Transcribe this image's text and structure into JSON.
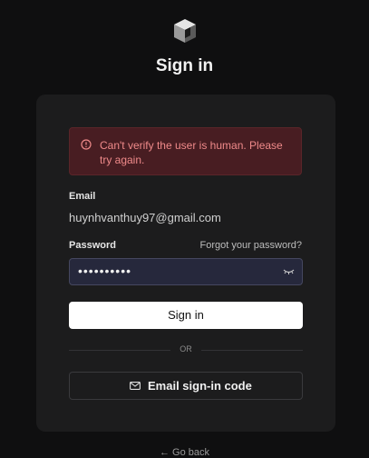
{
  "header": {
    "logo_icon": "cube-logo-icon",
    "title": "Sign in"
  },
  "alert": {
    "icon": "error-circle-icon",
    "message": "Can't verify the user is human. Please try again.",
    "color": "#ef8a8a",
    "background": "#481d22"
  },
  "form": {
    "email_label": "Email",
    "email_value": "huynhvanthuy97@gmail.com",
    "password_label": "Password",
    "forgot_link": "Forgot your password?",
    "password_masked": "••••••••••",
    "password_toggle_icon": "eye-closed-icon",
    "signin_label": "Sign in",
    "divider_text": "OR",
    "email_code_icon": "mail-icon",
    "email_code_label": "Email sign-in code"
  },
  "footer": {
    "go_back": "← Go back"
  }
}
